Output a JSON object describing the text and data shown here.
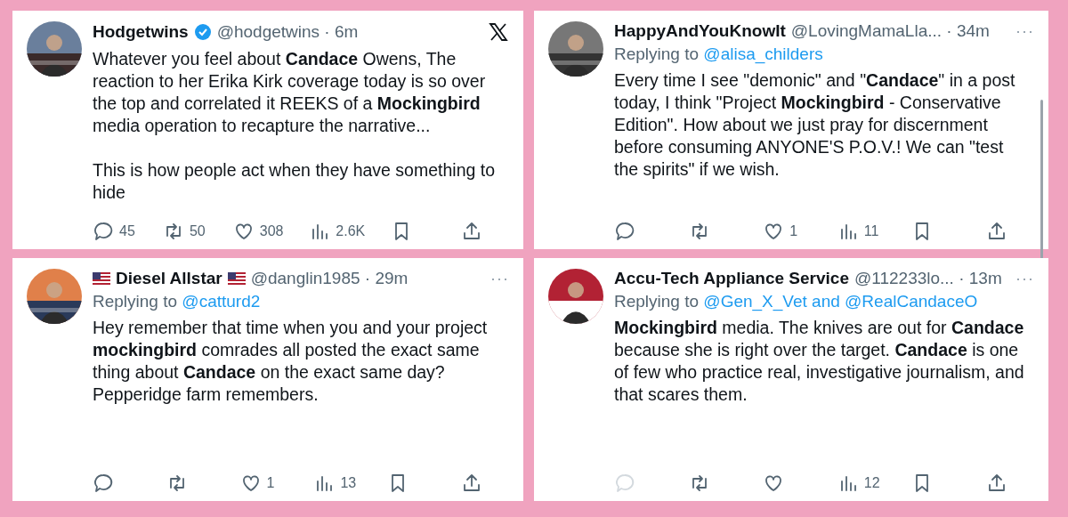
{
  "posts": [
    {
      "name": "Hodgetwins",
      "flags": false,
      "scrollbar": false,
      "verified": true,
      "handle": "@hodgetwins",
      "time": "· 6m",
      "corner": {
        "kind": "x-logo"
      },
      "avatar": {
        "kind": "picture"
      },
      "body": [
        "Whatever you feel about **Candace** Owens, The reaction to her Erika Kirk coverage today is so over the top and correlated it REEKS of a **Mockingbird** media operation to recapture the narrative...",
        "This is how people act when they have something to hide"
      ],
      "actions": [
        {
          "kind": "reply",
          "count": "45",
          "dimmed": false
        },
        {
          "kind": "repost",
          "count": "50",
          "dimmed": false
        },
        {
          "kind": "like",
          "count": "308",
          "dimmed": false
        },
        {
          "kind": "views",
          "count": "2.6K",
          "dimmed": false
        },
        {
          "kind": "bookmark",
          "dimmed": false
        },
        {
          "kind": "share",
          "dimmed": false
        }
      ]
    },
    {
      "name": "HappyAndYouKnowIt",
      "flags": false,
      "verified": false,
      "handle": "@LovingMamaLla...",
      "time": "· 34m",
      "corner": {
        "kind": "more",
        "text": "···"
      },
      "avatar": {
        "kind": "picture"
      },
      "reply_prefix": "Replying to",
      "reply_to": "@alisa_childers",
      "scrollbar": true,
      "body": [
        "Every time I see \"demonic\" and \"**Candace**\" in a post today, I think \"Project **Mockingbird** - Conservative Edition\".  How about we just pray for discernment before consuming ANYONE'S P.O.V.!  We can \"test the spirits\" if we wish."
      ],
      "actions": [
        {
          "kind": "reply",
          "dimmed": false
        },
        {
          "kind": "repost",
          "dimmed": false
        },
        {
          "kind": "like",
          "count": "1",
          "dimmed": false
        },
        {
          "kind": "views",
          "count": "11",
          "dimmed": false
        },
        {
          "kind": "bookmark",
          "dimmed": false
        },
        {
          "kind": "share",
          "dimmed": false
        }
      ]
    },
    {
      "name": "Diesel Allstar",
      "flags": true,
      "scrollbar": false,
      "verified": false,
      "handle": "@danglin1985",
      "time": "· 29m",
      "corner": {
        "kind": "more",
        "text": "···"
      },
      "avatar": {
        "kind": "picture"
      },
      "reply_prefix": "Replying to",
      "reply_to": "@catturd2",
      "body": [
        "Hey remember that time when you and your project **mockingbird** comrades all posted the exact same thing about **Candace** on the exact same day? Pepperidge farm remembers."
      ],
      "actions": [
        {
          "kind": "reply",
          "dimmed": false
        },
        {
          "kind": "repost",
          "dimmed": false
        },
        {
          "kind": "like",
          "count": "1",
          "dimmed": false
        },
        {
          "kind": "views",
          "count": "13",
          "dimmed": false
        },
        {
          "kind": "bookmark",
          "dimmed": false
        },
        {
          "kind": "share",
          "dimmed": false
        }
      ]
    },
    {
      "name": "Accu-Tech Appliance Service",
      "flags": false,
      "scrollbar": false,
      "verified": false,
      "handle": "@112233lo...",
      "time": "· 13m",
      "corner": {
        "kind": "more",
        "text": "···"
      },
      "avatar": {
        "kind": "picture"
      },
      "reply_prefix": "Replying to",
      "reply_to": "@Gen_X_Vet and @RealCandaceO",
      "body": [
        "**Mockingbird** media. The knives are out for **Candace** because she is right over the target. **Candace** is one of few who practice real, investigative journalism, and that scares them."
      ],
      "actions": [
        {
          "kind": "reply",
          "dimmed": true
        },
        {
          "kind": "repost",
          "dimmed": false
        },
        {
          "kind": "like",
          "dimmed": false
        },
        {
          "kind": "views",
          "count": "12",
          "dimmed": false
        },
        {
          "kind": "bookmark",
          "dimmed": false
        },
        {
          "kind": "share",
          "dimmed": false
        }
      ]
    }
  ]
}
